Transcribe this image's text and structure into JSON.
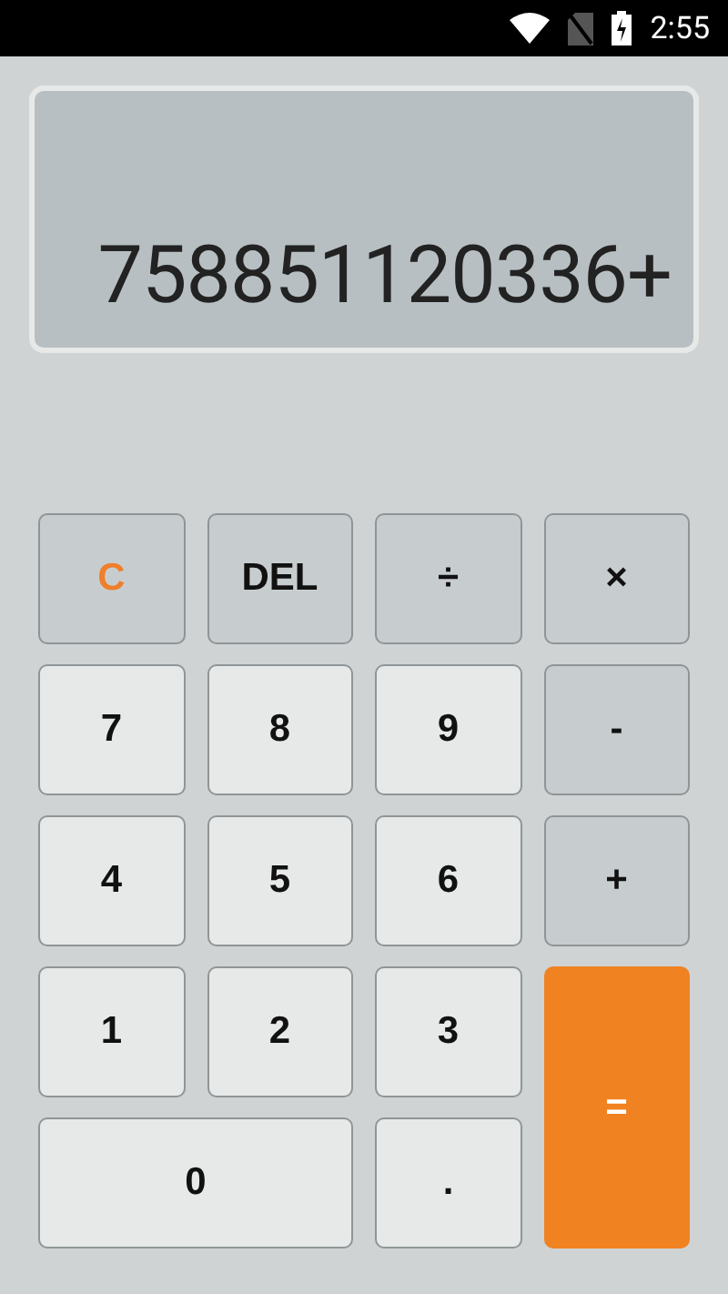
{
  "status_bar": {
    "time": "2:55"
  },
  "display": {
    "expression": "758851120336+"
  },
  "keys": [
    {
      "label": "C",
      "kind": "clear"
    },
    {
      "label": "DEL",
      "kind": "operator"
    },
    {
      "label": "÷",
      "kind": "operator"
    },
    {
      "label": "×",
      "kind": "operator"
    },
    {
      "label": "7",
      "kind": "digit"
    },
    {
      "label": "8",
      "kind": "digit"
    },
    {
      "label": "9",
      "kind": "digit"
    },
    {
      "label": "-",
      "kind": "operator"
    },
    {
      "label": "4",
      "kind": "digit"
    },
    {
      "label": "5",
      "kind": "digit"
    },
    {
      "label": "6",
      "kind": "digit"
    },
    {
      "label": "+",
      "kind": "operator"
    },
    {
      "label": "1",
      "kind": "digit"
    },
    {
      "label": "2",
      "kind": "digit"
    },
    {
      "label": "3",
      "kind": "digit"
    },
    {
      "label": "=",
      "kind": "equals"
    },
    {
      "label": "0",
      "kind": "wide"
    },
    {
      "label": ".",
      "kind": "digit"
    }
  ]
}
